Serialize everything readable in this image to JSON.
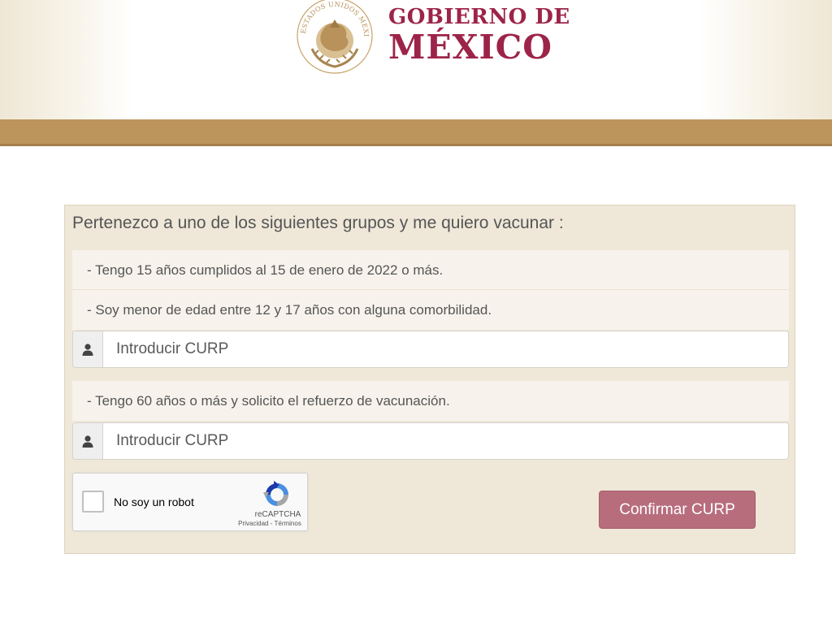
{
  "header": {
    "line1": "GOBIERNO DE",
    "line2": "MÉXICO",
    "seal_text": "ESTADOS UNIDOS MEXICANOS",
    "brand_color": "#9d2449",
    "gold_color": "#bc955c"
  },
  "panel": {
    "title": "Pertenezco a uno de los siguientes grupos y me quiero vacunar :",
    "groups": [
      {
        "label": "- Tengo 15 años cumplidos al 15 de enero de 2022 o más."
      },
      {
        "label": "- Soy menor de edad entre 12 y 17 años con alguna comorbilidad."
      },
      {
        "label": "- Tengo 60 años o más y solicito el refuerzo de vacunación."
      }
    ],
    "curp_inputs": [
      {
        "placeholder": "Introducir CURP",
        "value": "",
        "icon": "user-icon"
      },
      {
        "placeholder": "Introducir CURP",
        "value": "",
        "icon": "user-icon"
      }
    ]
  },
  "captcha": {
    "label": "No soy un robot",
    "brand": "reCAPTCHA",
    "privacy": "Privacidad",
    "separator": " - ",
    "terms": "Términos",
    "checked": false
  },
  "actions": {
    "confirm_label": "Confirmar CURP",
    "confirm_color": "#b76d7c"
  }
}
